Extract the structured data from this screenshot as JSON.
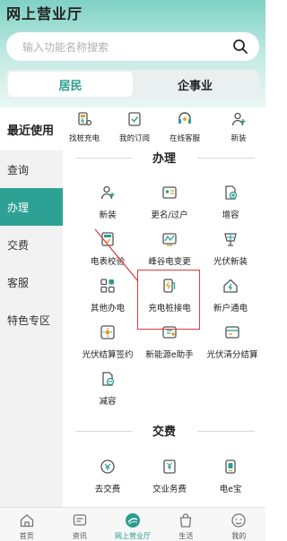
{
  "app": {
    "title": "网上营业厅"
  },
  "search": {
    "placeholder": "输入功能名称搜索"
  },
  "segment": {
    "tabs": [
      "居民",
      "企事业"
    ],
    "active": 0
  },
  "sidebar": {
    "recent_label": "最近使用",
    "items": [
      {
        "label": "查询"
      },
      {
        "label": "办理",
        "active": true
      },
      {
        "label": "交费"
      },
      {
        "label": "客服"
      },
      {
        "label": "特色专区"
      }
    ]
  },
  "recent": {
    "items": [
      {
        "label": "找桩充电",
        "icon": "charging-pile-search-icon"
      },
      {
        "label": "我的订阅",
        "icon": "subscription-icon"
      },
      {
        "label": "在线客服",
        "icon": "headset-icon"
      },
      {
        "label": "新装",
        "icon": "user-add-icon"
      }
    ]
  },
  "handle": {
    "title": "办理",
    "items": [
      {
        "label": "新装",
        "icon": "user-add-icon"
      },
      {
        "label": "更名/过户",
        "icon": "rename-transfer-icon"
      },
      {
        "label": "增容",
        "icon": "capacity-increase-icon"
      },
      {
        "label": "电表校验",
        "icon": "meter-check-icon"
      },
      {
        "label": "峰谷电变更",
        "icon": "peak-valley-icon"
      },
      {
        "label": "光伏新装",
        "icon": "solar-panel-icon"
      },
      {
        "label": "其他办电",
        "icon": "grid-apps-icon"
      },
      {
        "label": "充电桩接电",
        "icon": "charging-pile-icon",
        "highlighted": true
      },
      {
        "label": "新户通电",
        "icon": "house-power-icon"
      },
      {
        "label": "光伏结算签约",
        "icon": "solar-settlement-icon"
      },
      {
        "label": "新能源e助手",
        "icon": "new-energy-icon"
      },
      {
        "label": "光伏清分结算",
        "icon": "solar-clearing-icon"
      },
      {
        "label": "减容",
        "icon": "capacity-reduce-icon"
      }
    ]
  },
  "payment": {
    "title": "交费",
    "items": [
      {
        "label": "去交费",
        "icon": "pay-icon"
      },
      {
        "label": "交业务费",
        "icon": "business-fee-icon"
      },
      {
        "label": "电e宝",
        "icon": "wallet-icon"
      }
    ]
  },
  "tabbar": {
    "items": [
      {
        "label": "首页",
        "icon": "home-icon"
      },
      {
        "label": "资讯",
        "icon": "news-icon"
      },
      {
        "label": "网上营业厅",
        "icon": "service-hall-icon",
        "active": true
      },
      {
        "label": "生活",
        "icon": "life-bag-icon"
      },
      {
        "label": "我的",
        "icon": "profile-icon"
      }
    ]
  },
  "colors": {
    "accent": "#2a9d8f",
    "highlight": "#e23b3b"
  }
}
